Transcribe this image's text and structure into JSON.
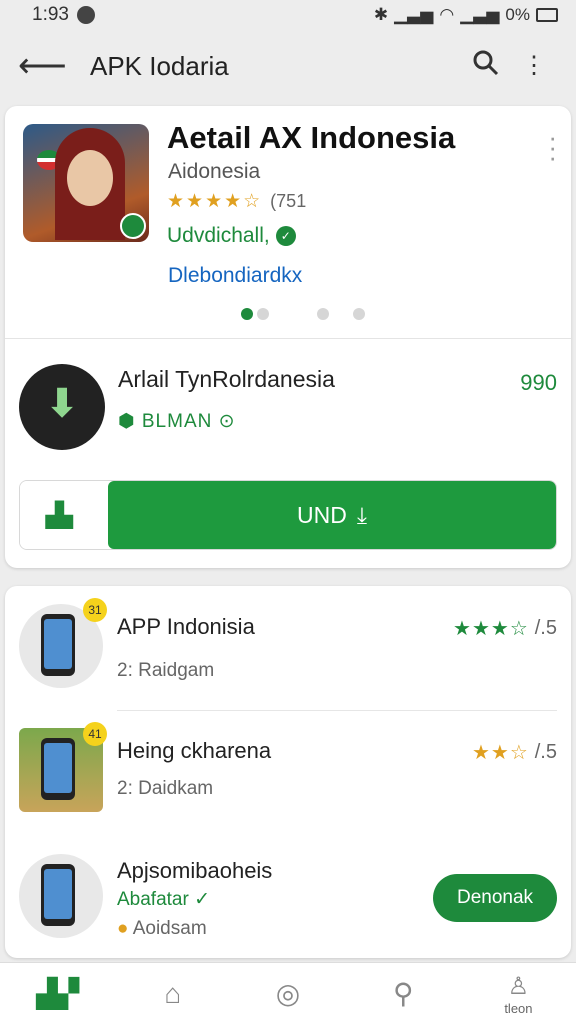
{
  "status": {
    "time": "1:93",
    "battery": "0%"
  },
  "appbar": {
    "title": "APK Iodaria"
  },
  "hero": {
    "title": "Aetail AX Indonesia",
    "developer": "Aidonesia",
    "stars": "★★★★☆",
    "rating_count": "(751",
    "verified": "Udvdichall,",
    "link": "Dlebondiardkx"
  },
  "download": {
    "title": "Arlail TynRolrdanesia",
    "subtitle": "BLMAN",
    "price": "990",
    "button_label": "UND"
  },
  "list": [
    {
      "name": "APP Indonisia",
      "sub": "2: Raidgam",
      "stars": "★★★☆",
      "rating": "/.5",
      "badge": "31"
    },
    {
      "name": "Heing ckharena",
      "sub": "2: Daidkam",
      "stars": "★★☆",
      "rating": "/.5",
      "badge": "41"
    },
    {
      "name": "Apjsomibaoheis",
      "sub": "Abafatar ✓",
      "sub2": "Aoidsam",
      "button": "Denonak"
    }
  ],
  "nav": {
    "profile_label": "tleon"
  },
  "colors": {
    "accent": "#1e8a3c",
    "star_gold": "#e0a020",
    "link": "#1565c0"
  }
}
